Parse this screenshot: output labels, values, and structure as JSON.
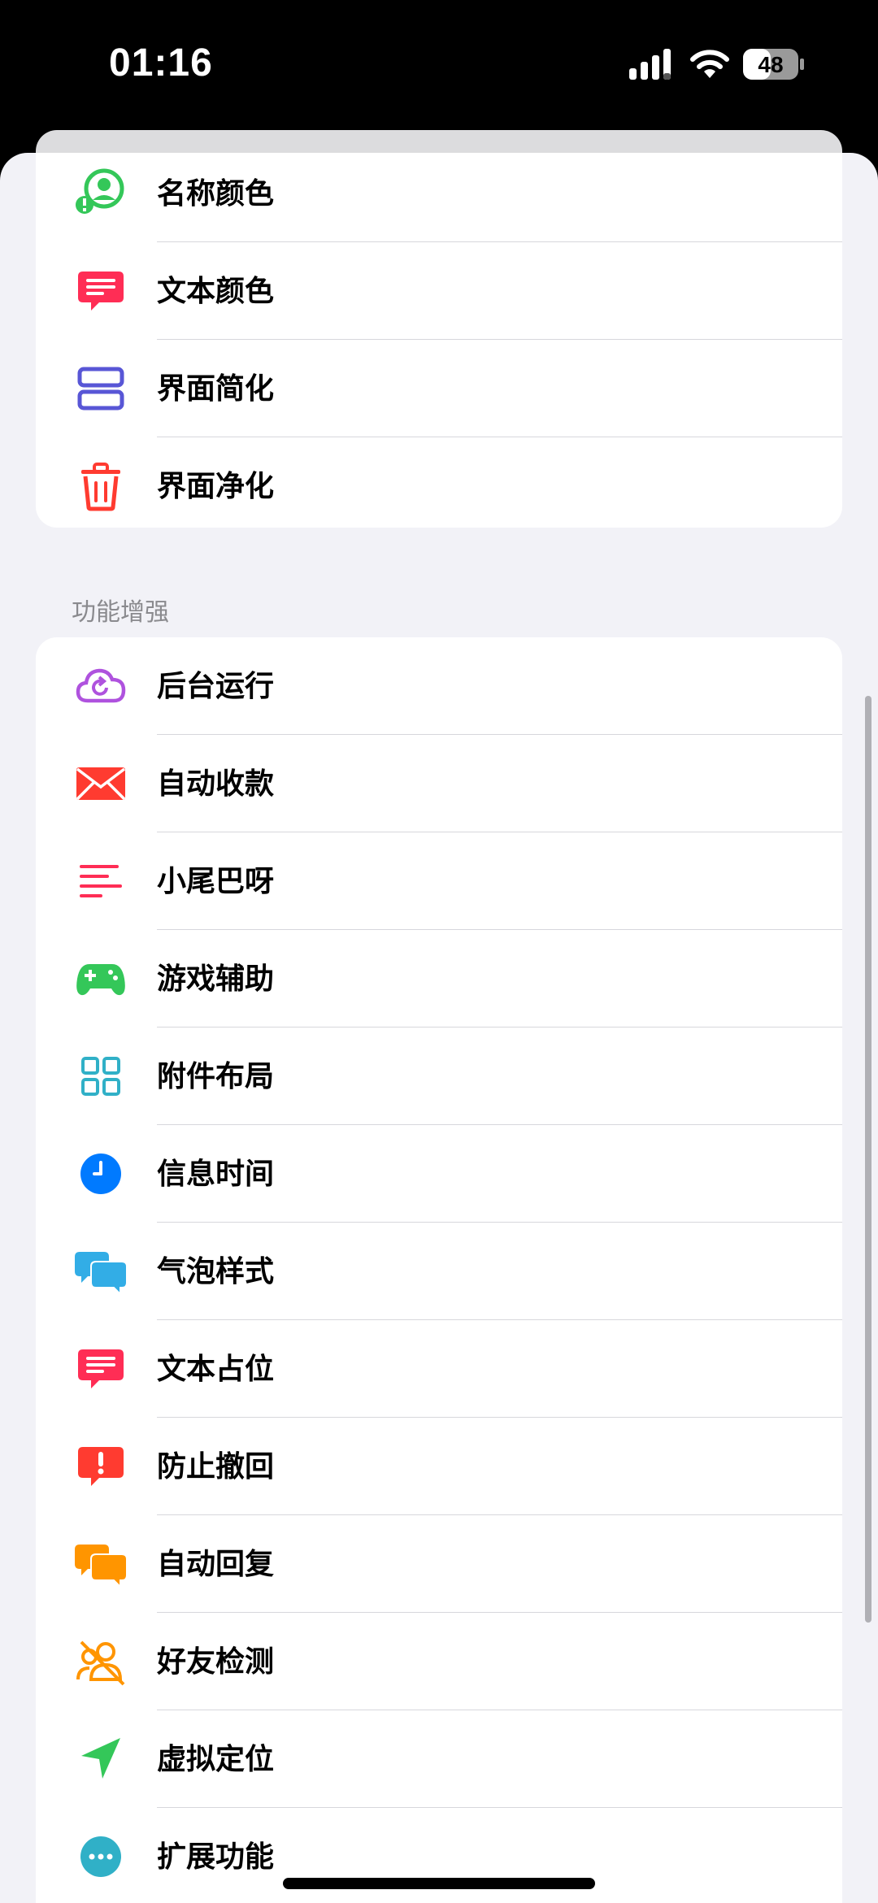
{
  "status_bar": {
    "time": "01:16",
    "battery_level": "48"
  },
  "top_group": {
    "items": [
      {
        "label": "名称颜色",
        "icon": "person-badge-icon",
        "color": "#34c759"
      },
      {
        "label": "文本颜色",
        "icon": "text-bubble-icon",
        "color": "#ff2d55"
      },
      {
        "label": "界面简化",
        "icon": "layout-rows-icon",
        "color": "#5856d6"
      },
      {
        "label": "界面净化",
        "icon": "trash-icon",
        "color": "#ff3b30"
      }
    ]
  },
  "enhance_section": {
    "header": "功能增强",
    "items": [
      {
        "label": "后台运行",
        "icon": "cloud-refresh-icon",
        "color": "#af52de"
      },
      {
        "label": "自动收款",
        "icon": "envelope-icon",
        "color": "#ff3b30"
      },
      {
        "label": "小尾巴呀",
        "icon": "text-lines-icon",
        "color": "#ff2d55"
      },
      {
        "label": "游戏辅助",
        "icon": "gamepad-icon",
        "color": "#34c759"
      },
      {
        "label": "附件布局",
        "icon": "grid-icon",
        "color": "#30b0c7"
      },
      {
        "label": "信息时间",
        "icon": "clock-icon",
        "color": "#007aff"
      },
      {
        "label": "气泡样式",
        "icon": "chat-bubbles-icon",
        "color": "#32ade6"
      },
      {
        "label": "文本占位",
        "icon": "text-bubble-icon",
        "color": "#ff2d55"
      },
      {
        "label": "防止撤回",
        "icon": "alert-bubble-icon",
        "color": "#ff3b30"
      },
      {
        "label": "自动回复",
        "icon": "chat-bubbles-icon",
        "color": "#ff9500"
      },
      {
        "label": "好友检测",
        "icon": "person-slash-icon",
        "color": "#ff9500"
      },
      {
        "label": "虚拟定位",
        "icon": "location-arrow-icon",
        "color": "#34c759"
      },
      {
        "label": "扩展功能",
        "icon": "more-circle-icon",
        "color": "#30b0c7"
      }
    ]
  }
}
